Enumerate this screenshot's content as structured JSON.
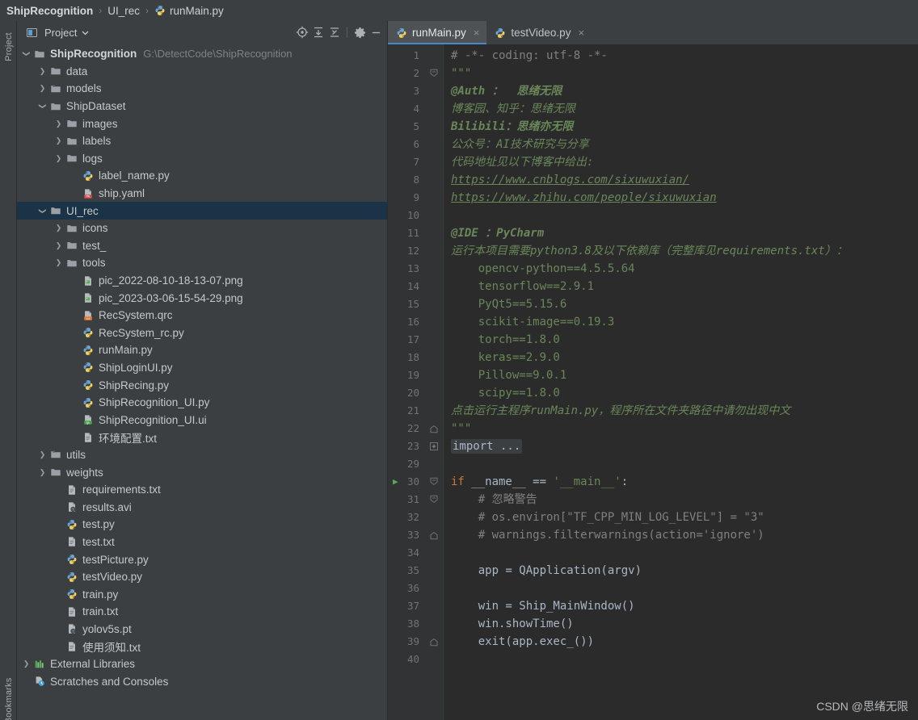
{
  "breadcrumb": {
    "items": [
      {
        "label": "ShipRecognition",
        "icon": "none",
        "bold": true
      },
      {
        "label": "UI_rec",
        "icon": "none",
        "bold": false
      },
      {
        "label": "runMain.py",
        "icon": "python-file-icon",
        "bold": false
      }
    ],
    "separator": "›"
  },
  "project_panel": {
    "title": "Project",
    "dropdown_icon": "chevron-down-icon",
    "panel_icon": "project-window-icon",
    "toolbar_icons": [
      {
        "name": "locate-in-tree-icon",
        "glyph": "target"
      },
      {
        "name": "expand-all-icon",
        "glyph": "expand"
      },
      {
        "name": "collapse-all-icon",
        "glyph": "collapse"
      },
      {
        "name": "settings-gear-icon",
        "glyph": "gear"
      },
      {
        "name": "hide-panel-icon",
        "glyph": "minus"
      }
    ],
    "tree": [
      {
        "label": "ShipRecognition",
        "note": "G:\\DetectCode\\ShipRecognition",
        "depth": 0,
        "arrow": "open",
        "icon": "folder-module",
        "bold": true,
        "selected": false
      },
      {
        "label": "data",
        "note": "",
        "depth": 1,
        "arrow": "closed",
        "icon": "folder",
        "bold": false,
        "selected": false
      },
      {
        "label": "models",
        "note": "",
        "depth": 1,
        "arrow": "closed",
        "icon": "folder-source",
        "bold": false,
        "selected": false
      },
      {
        "label": "ShipDataset",
        "note": "",
        "depth": 1,
        "arrow": "open",
        "icon": "folder",
        "bold": false,
        "selected": false
      },
      {
        "label": "images",
        "note": "",
        "depth": 2,
        "arrow": "closed",
        "icon": "folder",
        "bold": false,
        "selected": false
      },
      {
        "label": "labels",
        "note": "",
        "depth": 2,
        "arrow": "closed",
        "icon": "folder",
        "bold": false,
        "selected": false
      },
      {
        "label": "logs",
        "note": "",
        "depth": 2,
        "arrow": "closed",
        "icon": "folder",
        "bold": false,
        "selected": false
      },
      {
        "label": "label_name.py",
        "note": "",
        "depth": 3,
        "arrow": "none",
        "icon": "python-file",
        "bold": false,
        "selected": false
      },
      {
        "label": "ship.yaml",
        "note": "",
        "depth": 3,
        "arrow": "none",
        "icon": "yaml-file",
        "bold": false,
        "selected": false
      },
      {
        "label": "UI_rec",
        "note": "",
        "depth": 1,
        "arrow": "open",
        "icon": "folder",
        "bold": false,
        "selected": true
      },
      {
        "label": "icons",
        "note": "",
        "depth": 2,
        "arrow": "closed",
        "icon": "folder",
        "bold": false,
        "selected": false
      },
      {
        "label": "test_",
        "note": "",
        "depth": 2,
        "arrow": "closed",
        "icon": "folder",
        "bold": false,
        "selected": false
      },
      {
        "label": "tools",
        "note": "",
        "depth": 2,
        "arrow": "closed",
        "icon": "folder",
        "bold": false,
        "selected": false
      },
      {
        "label": "pic_2022-08-10-18-13-07.png",
        "note": "",
        "depth": 3,
        "arrow": "none",
        "icon": "image-file",
        "bold": false,
        "selected": false
      },
      {
        "label": "pic_2023-03-06-15-54-29.png",
        "note": "",
        "depth": 3,
        "arrow": "none",
        "icon": "image-file",
        "bold": false,
        "selected": false
      },
      {
        "label": "RecSystem.qrc",
        "note": "",
        "depth": 3,
        "arrow": "none",
        "icon": "qrc-file",
        "bold": false,
        "selected": false
      },
      {
        "label": "RecSystem_rc.py",
        "note": "",
        "depth": 3,
        "arrow": "none",
        "icon": "python-file",
        "bold": false,
        "selected": false
      },
      {
        "label": "runMain.py",
        "note": "",
        "depth": 3,
        "arrow": "none",
        "icon": "python-file",
        "bold": false,
        "selected": false
      },
      {
        "label": "ShipLoginUI.py",
        "note": "",
        "depth": 3,
        "arrow": "none",
        "icon": "python-file",
        "bold": false,
        "selected": false
      },
      {
        "label": "ShipRecing.py",
        "note": "",
        "depth": 3,
        "arrow": "none",
        "icon": "python-file",
        "bold": false,
        "selected": false
      },
      {
        "label": "ShipRecognition_UI.py",
        "note": "",
        "depth": 3,
        "arrow": "none",
        "icon": "python-file",
        "bold": false,
        "selected": false
      },
      {
        "label": "ShipRecognition_UI.ui",
        "note": "",
        "depth": 3,
        "arrow": "none",
        "icon": "qt-ui-file",
        "bold": false,
        "selected": false
      },
      {
        "label": "环境配置.txt",
        "note": "",
        "depth": 3,
        "arrow": "none",
        "icon": "text-file",
        "bold": false,
        "selected": false
      },
      {
        "label": "utils",
        "note": "",
        "depth": 1,
        "arrow": "closed",
        "icon": "folder-source",
        "bold": false,
        "selected": false
      },
      {
        "label": "weights",
        "note": "",
        "depth": 1,
        "arrow": "closed",
        "icon": "folder",
        "bold": false,
        "selected": false
      },
      {
        "label": "requirements.txt",
        "note": "",
        "depth": 2,
        "arrow": "none",
        "icon": "text-file",
        "bold": false,
        "selected": false
      },
      {
        "label": "results.avi",
        "note": "",
        "depth": 2,
        "arrow": "none",
        "icon": "unknown-file",
        "bold": false,
        "selected": false
      },
      {
        "label": "test.py",
        "note": "",
        "depth": 2,
        "arrow": "none",
        "icon": "python-file",
        "bold": false,
        "selected": false
      },
      {
        "label": "test.txt",
        "note": "",
        "depth": 2,
        "arrow": "none",
        "icon": "text-file",
        "bold": false,
        "selected": false
      },
      {
        "label": "testPicture.py",
        "note": "",
        "depth": 2,
        "arrow": "none",
        "icon": "python-file",
        "bold": false,
        "selected": false
      },
      {
        "label": "testVideo.py",
        "note": "",
        "depth": 2,
        "arrow": "none",
        "icon": "python-file",
        "bold": false,
        "selected": false
      },
      {
        "label": "train.py",
        "note": "",
        "depth": 2,
        "arrow": "none",
        "icon": "python-file",
        "bold": false,
        "selected": false
      },
      {
        "label": "train.txt",
        "note": "",
        "depth": 2,
        "arrow": "none",
        "icon": "text-file",
        "bold": false,
        "selected": false
      },
      {
        "label": "yolov5s.pt",
        "note": "",
        "depth": 2,
        "arrow": "none",
        "icon": "unknown-file",
        "bold": false,
        "selected": false
      },
      {
        "label": "使用须知.txt",
        "note": "",
        "depth": 2,
        "arrow": "none",
        "icon": "text-file",
        "bold": false,
        "selected": false
      },
      {
        "label": "External Libraries",
        "note": "",
        "depth": 0,
        "arrow": "closed",
        "icon": "libraries",
        "bold": false,
        "selected": false
      },
      {
        "label": "Scratches and Consoles",
        "note": "",
        "depth": 0,
        "arrow": "none",
        "icon": "scratches",
        "bold": false,
        "selected": false
      }
    ]
  },
  "tool_window_tabs": {
    "left": "Project",
    "bottom_left": "Bookmarks"
  },
  "editor": {
    "tabs": [
      {
        "label": "runMain.py",
        "icon": "python-file-icon",
        "active": true,
        "close_glyph": "×"
      },
      {
        "label": "testVideo.py",
        "icon": "python-file-icon",
        "active": false,
        "close_glyph": "×"
      }
    ],
    "watermark": "CSDN @思绪无限",
    "lines": [
      {
        "num": "1",
        "fold": "",
        "run": false,
        "segments": [
          {
            "t": "# -*- coding: utf-8 -*-",
            "c": "c-comment"
          }
        ]
      },
      {
        "num": "2",
        "fold": "start",
        "run": false,
        "segments": [
          {
            "t": "\"\"\"",
            "c": "c-doc-mono"
          }
        ]
      },
      {
        "num": "3",
        "fold": "",
        "run": false,
        "segments": [
          {
            "t": "@Auth ：  思绪无限",
            "c": "c-doc"
          }
        ]
      },
      {
        "num": "4",
        "fold": "",
        "run": false,
        "segments": [
          {
            "t": "博客园、知乎：思绪无限",
            "c": "c-doc-plain"
          }
        ]
      },
      {
        "num": "5",
        "fold": "",
        "run": false,
        "segments": [
          {
            "t": "Bilibili：思绪亦无限",
            "c": "c-doc"
          }
        ]
      },
      {
        "num": "6",
        "fold": "",
        "run": false,
        "segments": [
          {
            "t": "公众号：AI技术研究与分享",
            "c": "c-doc-plain"
          }
        ]
      },
      {
        "num": "7",
        "fold": "",
        "run": false,
        "segments": [
          {
            "t": "代码地址见以下博客中给出:",
            "c": "c-doc-plain"
          }
        ]
      },
      {
        "num": "8",
        "fold": "",
        "run": false,
        "segments": [
          {
            "t": "https://www.cnblogs.com/sixuwuxian/",
            "c": "c-link"
          }
        ]
      },
      {
        "num": "9",
        "fold": "",
        "run": false,
        "segments": [
          {
            "t": "https://www.zhihu.com/people/sixuwuxian",
            "c": "c-link"
          }
        ]
      },
      {
        "num": "10",
        "fold": "",
        "run": false,
        "segments": []
      },
      {
        "num": "11",
        "fold": "",
        "run": false,
        "segments": [
          {
            "t": "@IDE ：PyCharm",
            "c": "c-doc"
          }
        ]
      },
      {
        "num": "12",
        "fold": "",
        "run": false,
        "segments": [
          {
            "t": "运行本项目需要python3.8及以下依赖库（完整库见requirements.txt）：",
            "c": "c-doc-plain"
          }
        ]
      },
      {
        "num": "13",
        "fold": "",
        "run": false,
        "segments": [
          {
            "t": "    opencv-python==4.5.5.64",
            "c": "c-doc-mono"
          }
        ]
      },
      {
        "num": "14",
        "fold": "",
        "run": false,
        "segments": [
          {
            "t": "    tensorflow==2.9.1",
            "c": "c-doc-mono"
          }
        ]
      },
      {
        "num": "15",
        "fold": "",
        "run": false,
        "segments": [
          {
            "t": "    PyQt5==5.15.6",
            "c": "c-doc-mono"
          }
        ]
      },
      {
        "num": "16",
        "fold": "",
        "run": false,
        "segments": [
          {
            "t": "    scikit-image==0.19.3",
            "c": "c-doc-mono"
          }
        ]
      },
      {
        "num": "17",
        "fold": "",
        "run": false,
        "segments": [
          {
            "t": "    torch==1.8.0",
            "c": "c-doc-mono"
          }
        ]
      },
      {
        "num": "18",
        "fold": "",
        "run": false,
        "segments": [
          {
            "t": "    keras==2.9.0",
            "c": "c-doc-mono"
          }
        ]
      },
      {
        "num": "19",
        "fold": "",
        "run": false,
        "segments": [
          {
            "t": "    Pillow==9.0.1",
            "c": "c-doc-mono"
          }
        ]
      },
      {
        "num": "20",
        "fold": "",
        "run": false,
        "segments": [
          {
            "t": "    scipy==1.8.0",
            "c": "c-doc-mono"
          }
        ]
      },
      {
        "num": "21",
        "fold": "",
        "run": false,
        "segments": [
          {
            "t": "点击运行主程序runMain.py，程序所在文件夹路径中请勿出现中文",
            "c": "c-doc-plain"
          }
        ]
      },
      {
        "num": "22",
        "fold": "end",
        "run": false,
        "segments": [
          {
            "t": "\"\"\"",
            "c": "c-doc-mono"
          }
        ]
      },
      {
        "num": "23",
        "fold": "plus",
        "run": false,
        "segments": [
          {
            "t": "import ...",
            "c": "c-fold"
          }
        ]
      },
      {
        "num": "29",
        "fold": "",
        "run": false,
        "segments": []
      },
      {
        "num": "30",
        "fold": "start",
        "run": true,
        "segments": [
          {
            "t": "if",
            "c": "c-kw"
          },
          {
            "t": " __name__ == ",
            "c": "c-ident"
          },
          {
            "t": "'__main__'",
            "c": "c-str"
          },
          {
            "t": ":",
            "c": "c-ident"
          }
        ]
      },
      {
        "num": "31",
        "fold": "start2",
        "run": false,
        "segments": [
          {
            "t": "    # 忽略警告",
            "c": "c-comment"
          }
        ]
      },
      {
        "num": "32",
        "fold": "",
        "run": false,
        "segments": [
          {
            "t": "    # os.environ[\"TF_CPP_MIN_LOG_LEVEL\"] = \"3\"",
            "c": "c-comment"
          }
        ]
      },
      {
        "num": "33",
        "fold": "end",
        "run": false,
        "segments": [
          {
            "t": "    # warnings.filterwarnings(action='ignore')",
            "c": "c-comment"
          }
        ]
      },
      {
        "num": "34",
        "fold": "",
        "run": false,
        "segments": []
      },
      {
        "num": "35",
        "fold": "",
        "run": false,
        "segments": [
          {
            "t": "    app = QApplication(argv)",
            "c": "c-ident"
          }
        ]
      },
      {
        "num": "36",
        "fold": "",
        "run": false,
        "segments": []
      },
      {
        "num": "37",
        "fold": "",
        "run": false,
        "segments": [
          {
            "t": "    win = Ship_MainWindow()",
            "c": "c-ident"
          }
        ]
      },
      {
        "num": "38",
        "fold": "",
        "run": false,
        "segments": [
          {
            "t": "    win.showTime()",
            "c": "c-ident"
          }
        ]
      },
      {
        "num": "39",
        "fold": "end",
        "run": false,
        "segments": [
          {
            "t": "    exit(app.exec_())",
            "c": "c-ident"
          }
        ]
      },
      {
        "num": "40",
        "fold": "",
        "run": false,
        "segments": []
      }
    ]
  },
  "colors": {
    "panel_bg": "#3c3f41",
    "editor_bg": "#2b2b2b",
    "gutter_bg": "#313335",
    "selection": "#1b3347",
    "tab_active_underline": "#4a88c7",
    "keyword": "#cc7832",
    "string": "#6a8759",
    "comment": "#808080",
    "identifier": "#a9b7c6",
    "run_arrow": "#5ba85b"
  }
}
